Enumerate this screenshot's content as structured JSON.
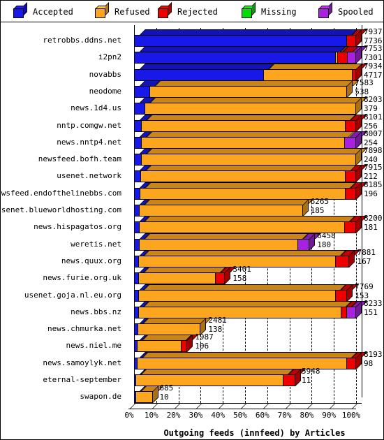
{
  "legend": {
    "items": [
      {
        "label": "Accepted",
        "color": "#1818e8",
        "icon": "cube-icon"
      },
      {
        "label": "Refused",
        "color": "#fca51e",
        "icon": "cube-icon"
      },
      {
        "label": "Rejected",
        "color": "#ee0000",
        "icon": "cube-icon"
      },
      {
        "label": "Missing",
        "color": "#00dd00",
        "icon": "cube-icon"
      },
      {
        "label": "Spooled",
        "color": "#a921e0",
        "icon": "cube-icon"
      }
    ]
  },
  "chart_data": {
    "type": "bar",
    "orientation": "horizontal",
    "stacked": true,
    "percent_of_total": true,
    "title": "Outgoing feeds (innfeed) by Articles",
    "xlabel": "Outgoing feeds (innfeed) by Articles",
    "ylabel": "",
    "xlim": [
      0,
      100
    ],
    "xticks": [
      "0%",
      "10%",
      "20%",
      "30%",
      "40%",
      "50%",
      "60%",
      "70%",
      "80%",
      "90%",
      "100%"
    ],
    "grid": true,
    "legend_position": "top",
    "series": [
      {
        "name": "Accepted",
        "color": "#1818e8"
      },
      {
        "name": "Refused",
        "color": "#fca51e"
      },
      {
        "name": "Rejected",
        "color": "#ee0000"
      },
      {
        "name": "Missing",
        "color": "#00dd00"
      },
      {
        "name": "Spooled",
        "color": "#a921e0"
      }
    ],
    "categories": [
      "retrobbs.ddns.net",
      "i2pn2",
      "novabbs",
      "neodome",
      "news.1d4.us",
      "nntp.comgw.net",
      "news.nntp4.net",
      "newsfeed.bofh.team",
      "usenet.network",
      "newsfeed.endofthelinebbs.com",
      "usenet.blueworldhosting.com",
      "news.hispagatos.org",
      "weretis.net",
      "news.quux.org",
      "news.furie.org.uk",
      "usenet.goja.nl.eu.org",
      "news.bbs.nz",
      "news.chmurka.net",
      "news.niel.me",
      "news.samoylyk.net",
      "eternal-september",
      "swapon.de"
    ],
    "rows": [
      {
        "label": "retrobbs.ddns.net",
        "total": 7937,
        "offered": 7736,
        "bar_pct": 100,
        "segments": [
          {
            "name": "Accepted",
            "pct": 95.5
          },
          {
            "name": "Rejected",
            "pct": 4.5
          }
        ]
      },
      {
        "label": "i2pn2",
        "total": 7753,
        "offered": 7301,
        "bar_pct": 100,
        "segments": [
          {
            "name": "Accepted",
            "pct": 90.5
          },
          {
            "name": "Refused",
            "pct": 0.9
          },
          {
            "name": "Rejected",
            "pct": 4.6
          },
          {
            "name": "Spooled",
            "pct": 4.0
          }
        ]
      },
      {
        "label": "novabbs",
        "total": 7934,
        "offered": 4717,
        "bar_pct": 100,
        "segments": [
          {
            "name": "Accepted",
            "pct": 58.2
          },
          {
            "name": "Refused",
            "pct": 40.0
          },
          {
            "name": "Rejected",
            "pct": 1.8
          }
        ]
      },
      {
        "label": "neodome",
        "total": 7583,
        "offered": 538,
        "bar_pct": 96,
        "segments": [
          {
            "name": "Accepted",
            "pct": 7.1
          },
          {
            "name": "Refused",
            "pct": 92.9
          }
        ]
      },
      {
        "label": "news.1d4.us",
        "total": 8203,
        "offered": 379,
        "bar_pct": 100,
        "segments": [
          {
            "name": "Accepted",
            "pct": 4.6
          },
          {
            "name": "Refused",
            "pct": 95.4
          }
        ]
      },
      {
        "label": "nntp.comgw.net",
        "total": 8101,
        "offered": 256,
        "bar_pct": 100,
        "segments": [
          {
            "name": "Accepted",
            "pct": 3.2
          },
          {
            "name": "Refused",
            "pct": 91.8
          },
          {
            "name": "Rejected",
            "pct": 5.0
          }
        ]
      },
      {
        "label": "news.nntp4.net",
        "total": 8007,
        "offered": 254,
        "bar_pct": 100,
        "segments": [
          {
            "name": "Accepted",
            "pct": 3.2
          },
          {
            "name": "Refused",
            "pct": 91.3
          },
          {
            "name": "Spooled",
            "pct": 5.5
          }
        ]
      },
      {
        "label": "newsfeed.bofh.team",
        "total": 7898,
        "offered": 240,
        "bar_pct": 100,
        "segments": [
          {
            "name": "Accepted",
            "pct": 3.0
          },
          {
            "name": "Refused",
            "pct": 97.0
          }
        ]
      },
      {
        "label": "usenet.network",
        "total": 7915,
        "offered": 212,
        "bar_pct": 100,
        "segments": [
          {
            "name": "Accepted",
            "pct": 2.7
          },
          {
            "name": "Refused",
            "pct": 92.3
          },
          {
            "name": "Rejected",
            "pct": 5.0
          }
        ]
      },
      {
        "label": "newsfeed.endofthelinebbs.com",
        "total": 8185,
        "offered": 196,
        "bar_pct": 100,
        "segments": [
          {
            "name": "Accepted",
            "pct": 2.4
          },
          {
            "name": "Refused",
            "pct": 92.6
          },
          {
            "name": "Rejected",
            "pct": 5.0
          }
        ]
      },
      {
        "label": "usenet.blueworldhosting.com",
        "total": 6265,
        "offered": 185,
        "bar_pct": 76,
        "segments": [
          {
            "name": "Accepted",
            "pct": 3.0
          },
          {
            "name": "Refused",
            "pct": 97.0
          }
        ]
      },
      {
        "label": "news.hispagatos.org",
        "total": 8200,
        "offered": 181,
        "bar_pct": 100,
        "segments": [
          {
            "name": "Accepted",
            "pct": 2.2
          },
          {
            "name": "Refused",
            "pct": 92.3
          },
          {
            "name": "Rejected",
            "pct": 5.5
          }
        ]
      },
      {
        "label": "weretis.net",
        "total": 6458,
        "offered": 180,
        "bar_pct": 79,
        "segments": [
          {
            "name": "Accepted",
            "pct": 2.8
          },
          {
            "name": "Refused",
            "pct": 90.2
          },
          {
            "name": "Spooled",
            "pct": 7.0
          }
        ]
      },
      {
        "label": "news.quux.org",
        "total": 7881,
        "offered": 167,
        "bar_pct": 97,
        "segments": [
          {
            "name": "Accepted",
            "pct": 2.1
          },
          {
            "name": "Refused",
            "pct": 91.4
          },
          {
            "name": "Rejected",
            "pct": 6.5
          }
        ]
      },
      {
        "label": "news.furie.org.uk",
        "total": 3401,
        "offered": 158,
        "bar_pct": 41,
        "segments": [
          {
            "name": "Accepted",
            "pct": 4.6
          },
          {
            "name": "Refused",
            "pct": 84.4
          },
          {
            "name": "Rejected",
            "pct": 11.0
          }
        ]
      },
      {
        "label": "usenet.goja.nl.eu.org",
        "total": 7769,
        "offered": 153,
        "bar_pct": 96,
        "segments": [
          {
            "name": "Accepted",
            "pct": 2.0
          },
          {
            "name": "Refused",
            "pct": 92.5
          },
          {
            "name": "Rejected",
            "pct": 5.5
          }
        ]
      },
      {
        "label": "news.bbs.nz",
        "total": 8233,
        "offered": 151,
        "bar_pct": 100,
        "segments": [
          {
            "name": "Accepted",
            "pct": 1.8
          },
          {
            "name": "Refused",
            "pct": 91.2
          },
          {
            "name": "Rejected",
            "pct": 2.5
          },
          {
            "name": "Spooled",
            "pct": 4.5
          }
        ]
      },
      {
        "label": "news.chmurka.net",
        "total": 2481,
        "offered": 138,
        "bar_pct": 30,
        "segments": [
          {
            "name": "Accepted",
            "pct": 5.5
          },
          {
            "name": "Refused",
            "pct": 94.5
          }
        ]
      },
      {
        "label": "news.niel.me",
        "total": 1987,
        "offered": 106,
        "bar_pct": 24,
        "segments": [
          {
            "name": "Accepted",
            "pct": 5.3
          },
          {
            "name": "Refused",
            "pct": 82.7
          },
          {
            "name": "Rejected",
            "pct": 12.0
          }
        ]
      },
      {
        "label": "news.samoylyk.net",
        "total": 8193,
        "offered": 98,
        "bar_pct": 100,
        "segments": [
          {
            "name": "Accepted",
            "pct": 1.2
          },
          {
            "name": "Refused",
            "pct": 94.3
          },
          {
            "name": "Rejected",
            "pct": 4.5
          }
        ]
      },
      {
        "label": "eternal-september",
        "total": 5948,
        "offered": 11,
        "bar_pct": 72,
        "segments": [
          {
            "name": "Accepted",
            "pct": 0.2
          },
          {
            "name": "Refused",
            "pct": 92.3
          },
          {
            "name": "Rejected",
            "pct": 7.5
          }
        ]
      },
      {
        "label": "swapon.de",
        "total": 685,
        "offered": 10,
        "bar_pct": 8,
        "segments": [
          {
            "name": "Accepted",
            "pct": 1.5
          },
          {
            "name": "Refused",
            "pct": 98.5
          }
        ]
      }
    ]
  }
}
